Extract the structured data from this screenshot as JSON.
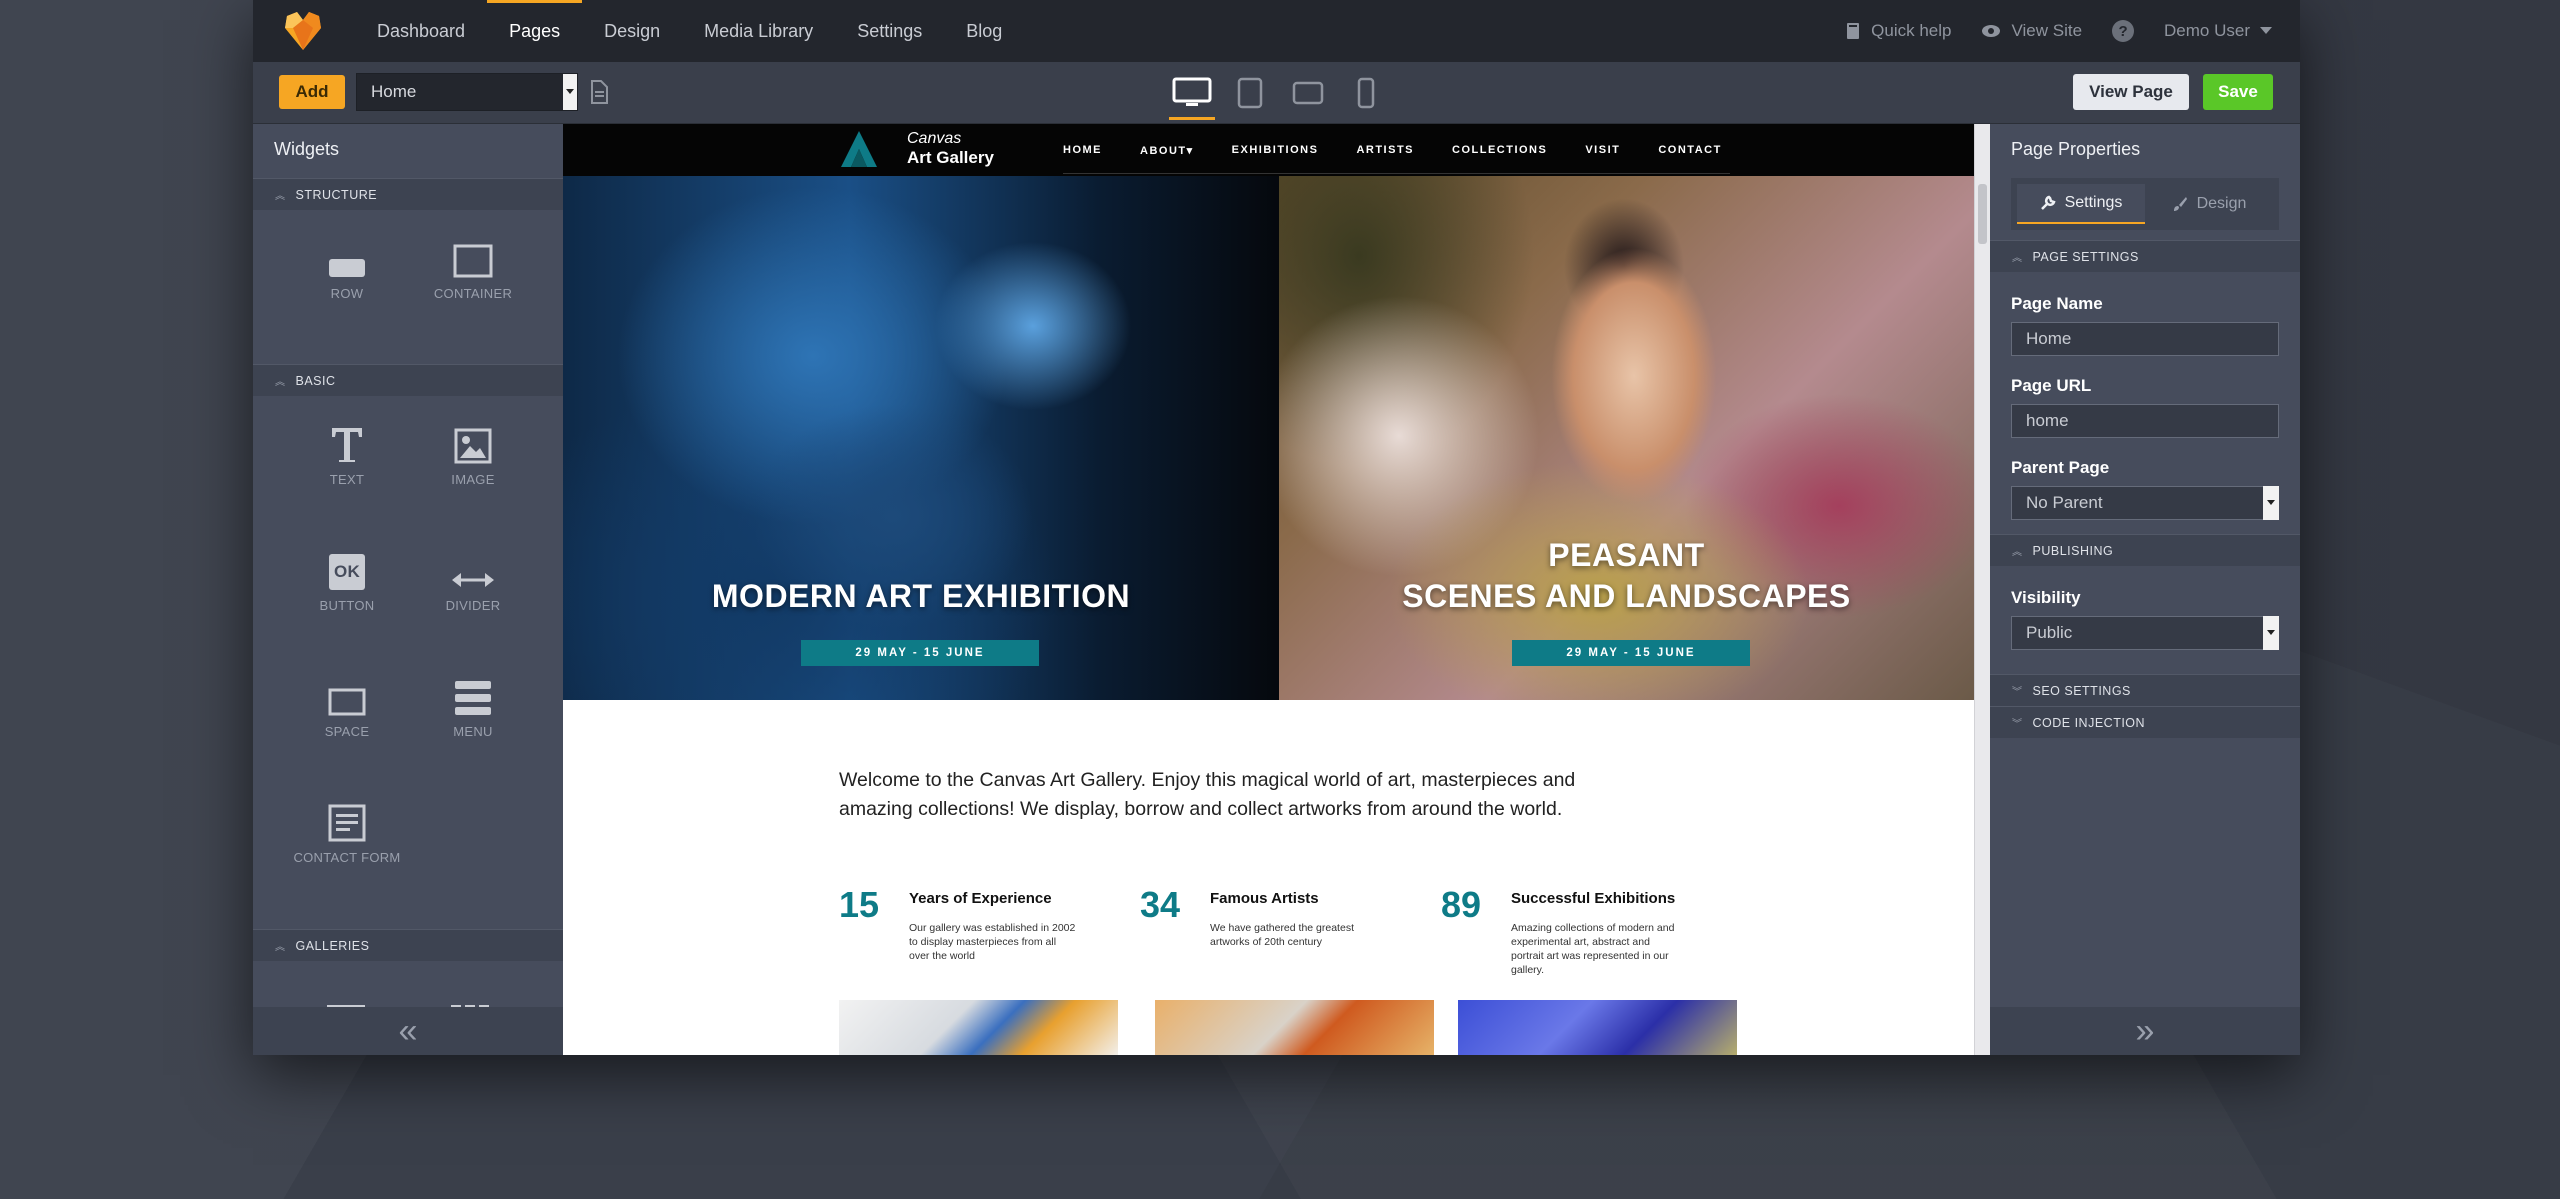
{
  "topnav": {
    "items": [
      "Dashboard",
      "Pages",
      "Design",
      "Media Library",
      "Settings",
      "Blog"
    ],
    "active": "Pages",
    "quick_help": "Quick help",
    "view_site": "View Site",
    "help_glyph": "?",
    "user": "Demo User"
  },
  "toolbar": {
    "add_label": "Add",
    "page_select_value": "Home",
    "view_page_label": "View Page",
    "save_label": "Save"
  },
  "left_panel": {
    "title": "Widgets",
    "sections": {
      "structure": "STRUCTURE",
      "basic": "BASIC",
      "galleries": "GALLERIES"
    },
    "widgets": {
      "row": "ROW",
      "container": "CONTAINER",
      "text": "TEXT",
      "image": "IMAGE",
      "button": "BUTTON",
      "button_glyph": "OK",
      "divider": "DIVIDER",
      "space": "SPACE",
      "menu": "MENU",
      "contact_form": "CONTACT FORM"
    },
    "collapse_glyph": "«"
  },
  "right_panel": {
    "title": "Page Properties",
    "tab_settings": "Settings",
    "tab_design": "Design",
    "sec_page_settings": "PAGE SETTINGS",
    "page_name_label": "Page Name",
    "page_name_value": "Home",
    "page_url_label": "Page URL",
    "page_url_value": "home",
    "parent_label": "Parent Page",
    "parent_value": "No Parent",
    "sec_publishing": "PUBLISHING",
    "visibility_label": "Visibility",
    "visibility_value": "Public",
    "sec_seo": "SEO SETTINGS",
    "sec_code": "CODE INJECTION",
    "expand_glyph": "»"
  },
  "site": {
    "logo_line1": "Canvas",
    "logo_line2": "Art Gallery",
    "menu": [
      "HOME",
      "ABOUT▾",
      "EXHIBITIONS",
      "ARTISTS",
      "COLLECTIONS",
      "VISIT",
      "CONTACT"
    ],
    "hero_left_title": "MODERN ART EXHIBITION",
    "hero_left_date": "29 MAY  - 15 JUNE",
    "hero_right_title_1": "PEASANT",
    "hero_right_title_2": "SCENES AND LANDSCAPES",
    "hero_right_date": "29 MAY  - 15 JUNE",
    "welcome": "Welcome to the Canvas Art Gallery.  Enjoy this magical world of art, masterpieces and amazing collections! We display, borrow and collect artworks from around the world.",
    "stats": [
      {
        "num": "15",
        "title": "Years of Experience",
        "desc": "Our gallery was established in 2002 to display masterpieces from all over the world"
      },
      {
        "num": "34",
        "title": "Famous Artists",
        "desc": "We have gathered the greatest artworks of 20th century"
      },
      {
        "num": "89",
        "title": "Successful Exhibitions",
        "desc": "Amazing collections of modern and experimental art, abstract and portrait art  was represented in our gallery."
      }
    ]
  },
  "colors": {
    "accent": "#f6a623",
    "save": "#5ac728",
    "teal": "#0e7b87"
  }
}
